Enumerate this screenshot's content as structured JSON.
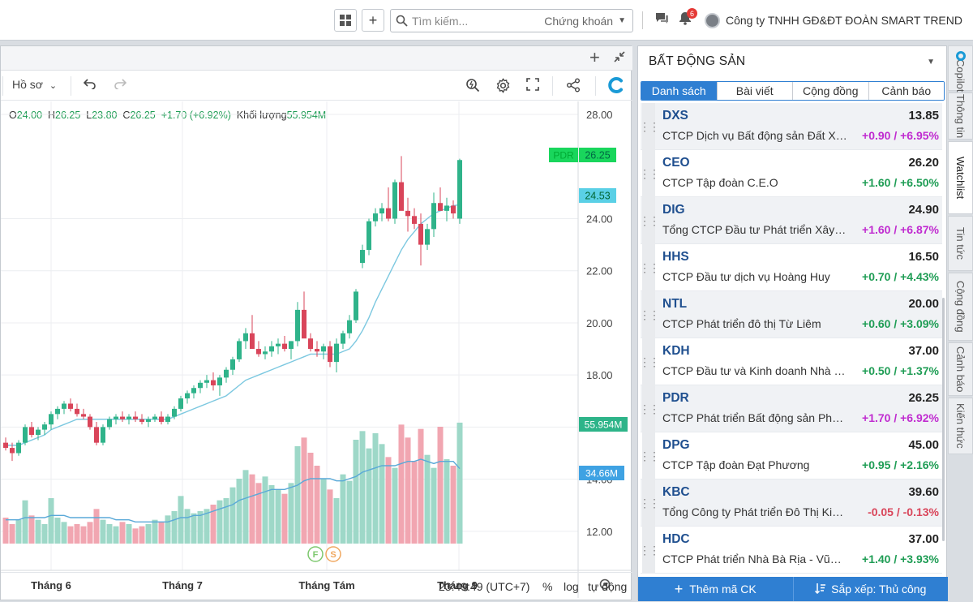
{
  "topbar": {
    "search_placeholder": "Tìm kiếm...",
    "search_scope": "Chứng khoán",
    "notification_count": "6",
    "company": "Công ty TNHH GĐ&ĐT ĐOÀN SMART TREND"
  },
  "chart_toolbar": {
    "profile": "Hồ sơ"
  },
  "legend": {
    "open_label": "O",
    "open": "24.00",
    "high_label": "H",
    "high": "26.25",
    "low_label": "L",
    "low": "23.80",
    "close_label": "C",
    "close": "26.25",
    "change": "+1.70 (+6.92%)",
    "volume_label": "Khối lượng",
    "volume": "55.954M"
  },
  "chart_data": {
    "type": "candlestick",
    "symbol": "PDR",
    "x_labels": [
      "Tháng 6",
      "Tháng 7",
      "Tháng Tám",
      "Tháng 9"
    ],
    "y_ticks": [
      "28.00",
      "24.00",
      "22.00",
      "20.00",
      "18.00",
      "16.00",
      "14.00",
      "12.00"
    ],
    "ylim": [
      10.5,
      28.5
    ],
    "price_tag": {
      "label": "PDR",
      "value": "26.25"
    },
    "ma_tag": "24.53",
    "volume_tag": "55.954M",
    "volume_ma_tag": "34.66M",
    "event_markers": [
      "F",
      "S"
    ],
    "up_color": "#2fb38a",
    "down_color": "#d9455a",
    "candles": [
      [
        15.4,
        15.6,
        15.1,
        15.2
      ],
      [
        15.2,
        15.4,
        14.7,
        15.0
      ],
      [
        15.0,
        15.5,
        14.9,
        15.4
      ],
      [
        15.4,
        16.1,
        15.3,
        16.0
      ],
      [
        16.0,
        16.2,
        15.6,
        15.7
      ],
      [
        15.7,
        16.0,
        15.5,
        15.9
      ],
      [
        15.9,
        16.2,
        15.7,
        16.1
      ],
      [
        16.1,
        16.6,
        15.9,
        16.5
      ],
      [
        16.5,
        16.8,
        16.3,
        16.7
      ],
      [
        16.7,
        17.0,
        16.5,
        16.9
      ],
      [
        16.9,
        17.1,
        16.6,
        16.7
      ],
      [
        16.7,
        16.9,
        16.4,
        16.5
      ],
      [
        16.5,
        16.7,
        16.3,
        16.4
      ],
      [
        16.4,
        16.5,
        15.9,
        16.0
      ],
      [
        16.0,
        16.2,
        15.3,
        15.4
      ],
      [
        15.4,
        16.1,
        15.3,
        16.0
      ],
      [
        16.0,
        16.4,
        15.9,
        16.3
      ],
      [
        16.3,
        16.5,
        16.1,
        16.4
      ],
      [
        16.4,
        16.6,
        16.2,
        16.3
      ],
      [
        16.3,
        16.5,
        16.1,
        16.4
      ],
      [
        16.4,
        16.6,
        16.2,
        16.3
      ],
      [
        16.3,
        16.5,
        16.1,
        16.2
      ],
      [
        16.2,
        16.4,
        16.0,
        16.3
      ],
      [
        16.3,
        16.5,
        16.2,
        16.4
      ],
      [
        16.4,
        16.6,
        16.1,
        16.2
      ],
      [
        16.2,
        16.5,
        16.1,
        16.4
      ],
      [
        16.4,
        16.8,
        16.3,
        16.7
      ],
      [
        16.7,
        17.2,
        16.6,
        17.1
      ],
      [
        17.1,
        17.4,
        16.9,
        17.3
      ],
      [
        17.3,
        17.6,
        17.1,
        17.5
      ],
      [
        17.5,
        17.8,
        17.3,
        17.7
      ],
      [
        17.7,
        18.0,
        17.5,
        17.8
      ],
      [
        17.8,
        18.1,
        17.4,
        17.6
      ],
      [
        17.6,
        18.0,
        17.2,
        17.9
      ],
      [
        17.9,
        18.3,
        17.7,
        18.2
      ],
      [
        18.2,
        18.7,
        18.0,
        18.6
      ],
      [
        18.6,
        19.4,
        18.5,
        19.3
      ],
      [
        19.3,
        19.8,
        19.0,
        19.6
      ],
      [
        19.6,
        20.3,
        19.2,
        19.0
      ],
      [
        19.0,
        19.3,
        18.7,
        18.8
      ],
      [
        18.8,
        19.1,
        18.6,
        18.9
      ],
      [
        18.9,
        19.3,
        18.7,
        19.1
      ],
      [
        19.1,
        19.4,
        18.8,
        19.2
      ],
      [
        19.2,
        19.5,
        18.9,
        19.0
      ],
      [
        19.0,
        19.3,
        18.6,
        19.3
      ],
      [
        19.3,
        20.8,
        19.1,
        20.5
      ],
      [
        20.5,
        21.2,
        20.1,
        19.4
      ],
      [
        19.4,
        19.6,
        18.9,
        19.0
      ],
      [
        19.0,
        19.3,
        18.7,
        18.9
      ],
      [
        18.9,
        19.2,
        18.6,
        19.1
      ],
      [
        19.1,
        19.3,
        18.3,
        18.5
      ],
      [
        18.5,
        19.4,
        18.1,
        19.2
      ],
      [
        19.2,
        19.7,
        19.0,
        19.6
      ],
      [
        19.6,
        20.3,
        19.4,
        20.1
      ],
      [
        20.1,
        21.3,
        20.0,
        21.2
      ],
      [
        22.3,
        23.0,
        22.1,
        22.8
      ],
      [
        22.8,
        24.0,
        22.6,
        23.9
      ],
      [
        23.9,
        24.4,
        23.7,
        24.2
      ],
      [
        24.2,
        24.6,
        23.9,
        24.4
      ],
      [
        24.4,
        25.2,
        23.9,
        24.0
      ],
      [
        24.0,
        25.5,
        23.8,
        25.4
      ],
      [
        25.4,
        26.4,
        24.8,
        24.3
      ],
      [
        24.3,
        24.8,
        23.5,
        24.1
      ],
      [
        24.1,
        24.4,
        23.6,
        23.8
      ],
      [
        23.8,
        24.2,
        22.2,
        23.0
      ],
      [
        23.0,
        23.8,
        22.8,
        23.6
      ],
      [
        23.6,
        25.0,
        23.3,
        24.6
      ],
      [
        24.6,
        25.2,
        24.3,
        24.3
      ],
      [
        24.3,
        24.8,
        23.9,
        24.5
      ],
      [
        24.5,
        24.7,
        24.0,
        24.2
      ],
      [
        24.0,
        26.3,
        23.8,
        26.25
      ]
    ],
    "volumes": [
      1.2,
      0.9,
      1.1,
      2.0,
      1.3,
      1.1,
      0.9,
      2.1,
      1.2,
      1.0,
      0.8,
      0.9,
      0.8,
      1.0,
      1.6,
      1.1,
      0.9,
      0.8,
      1.0,
      0.9,
      0.7,
      0.8,
      0.9,
      1.1,
      1.0,
      1.3,
      1.5,
      2.2,
      1.6,
      1.4,
      1.5,
      1.6,
      1.8,
      2.0,
      2.1,
      2.6,
      3.0,
      3.4,
      3.2,
      2.8,
      3.1,
      2.7,
      2.5,
      2.3,
      2.8,
      4.5,
      4.9,
      4.2,
      3.6,
      3.0,
      2.5,
      2.1,
      3.2,
      2.9,
      4.8,
      5.2,
      4.4,
      5.1,
      4.6,
      4.0,
      3.5,
      5.5,
      4.9,
      3.8,
      5.3,
      4.1,
      3.5,
      5.4,
      3.9,
      3.6,
      5.59
    ],
    "ma": [
      15.3,
      15.3,
      15.3,
      15.4,
      15.5,
      15.6,
      15.7,
      15.9,
      16.0,
      16.1,
      16.2,
      16.3,
      16.3,
      16.3,
      16.3,
      16.3,
      16.3,
      16.3,
      16.3,
      16.3,
      16.3,
      16.3,
      16.3,
      16.3,
      16.3,
      16.3,
      16.4,
      16.5,
      16.6,
      16.7,
      16.8,
      16.9,
      17.0,
      17.1,
      17.2,
      17.4,
      17.6,
      17.8,
      17.9,
      18.0,
      18.1,
      18.2,
      18.3,
      18.4,
      18.5,
      18.6,
      18.7,
      18.8,
      18.8,
      18.8,
      18.8,
      18.8,
      18.9,
      19.0,
      19.3,
      19.7,
      20.2,
      20.8,
      21.3,
      21.8,
      22.3,
      22.8,
      23.2,
      23.5,
      23.8,
      24.0,
      24.2,
      24.3,
      24.4,
      24.5,
      24.53
    ],
    "volume_ma": [
      1.1,
      1.1,
      1.1,
      1.2,
      1.2,
      1.2,
      1.2,
      1.3,
      1.3,
      1.3,
      1.2,
      1.2,
      1.2,
      1.2,
      1.2,
      1.2,
      1.2,
      1.1,
      1.1,
      1.1,
      1.0,
      1.0,
      1.0,
      1.0,
      1.0,
      1.0,
      1.1,
      1.2,
      1.2,
      1.3,
      1.3,
      1.4,
      1.5,
      1.6,
      1.7,
      1.8,
      2.0,
      2.1,
      2.2,
      2.3,
      2.4,
      2.5,
      2.5,
      2.5,
      2.6,
      2.7,
      2.9,
      3.0,
      3.0,
      3.0,
      3.0,
      2.9,
      2.9,
      3.0,
      3.1,
      3.3,
      3.4,
      3.5,
      3.6,
      3.6,
      3.6,
      3.7,
      3.8,
      3.8,
      3.9,
      3.8,
      3.7,
      3.8,
      3.8,
      3.8,
      3.466
    ]
  },
  "time_display": {
    "clock": "23:49:49 (UTC+7)",
    "percent": "%",
    "log": "log",
    "auto": "tự động"
  },
  "watchlist": {
    "title": "BẤT ĐỘNG SẢN",
    "tabs": [
      "Danh sách",
      "Bài viết",
      "Cộng đồng",
      "Cảnh báo"
    ],
    "items": [
      {
        "symbol": "DXS",
        "price": "13.85",
        "name": "CTCP Dịch vụ Bất động sản Đất Xanh",
        "change": "+0.90 / +6.95%",
        "color": "#c02bd0"
      },
      {
        "symbol": "CEO",
        "price": "26.20",
        "name": "CTCP Tập đoàn C.E.O",
        "change": "+1.60 / +6.50%",
        "color": "#1f9d55"
      },
      {
        "symbol": "DIG",
        "price": "24.90",
        "name": "Tổng CTCP Đầu tư Phát triển Xây dựng",
        "change": "+1.60 / +6.87%",
        "color": "#c02bd0"
      },
      {
        "symbol": "HHS",
        "price": "16.50",
        "name": "CTCP Đầu tư dịch vụ Hoàng Huy",
        "change": "+0.70 / +4.43%",
        "color": "#1f9d55"
      },
      {
        "symbol": "NTL",
        "price": "20.00",
        "name": "CTCP Phát triển đô thị Từ Liêm",
        "change": "+0.60 / +3.09%",
        "color": "#1f9d55"
      },
      {
        "symbol": "KDH",
        "price": "37.00",
        "name": "CTCP Đầu tư và Kinh doanh Nhà Khang Điền",
        "change": "+0.50 / +1.37%",
        "color": "#1f9d55"
      },
      {
        "symbol": "PDR",
        "price": "26.25",
        "name": "CTCP Phát triển Bất động sản Phát Đạt",
        "change": "+1.70 / +6.92%",
        "color": "#c02bd0"
      },
      {
        "symbol": "DPG",
        "price": "45.00",
        "name": "CTCP Tập đoàn Đạt Phương",
        "change": "+0.95 / +2.16%",
        "color": "#1f9d55"
      },
      {
        "symbol": "KBC",
        "price": "39.60",
        "name": "Tổng Công ty Phát triển Đô Thị Kinh Bắc",
        "change": "-0.05 / -0.13%",
        "color": "#d9455a"
      },
      {
        "symbol": "HDC",
        "price": "37.00",
        "name": "CTCP Phát triển Nhà Bà Rịa - Vũng Tàu",
        "change": "+1.40 / +3.93%",
        "color": "#1f9d55"
      }
    ],
    "footer": {
      "add": "Thêm mã CK",
      "sort": "Sắp xếp: Thủ công"
    }
  },
  "side_tabs": [
    "Copilot",
    "Thông tin",
    "Watchlist",
    "Tin tức",
    "Cộng đồng",
    "Cảnh báo",
    "Kiến thức"
  ]
}
